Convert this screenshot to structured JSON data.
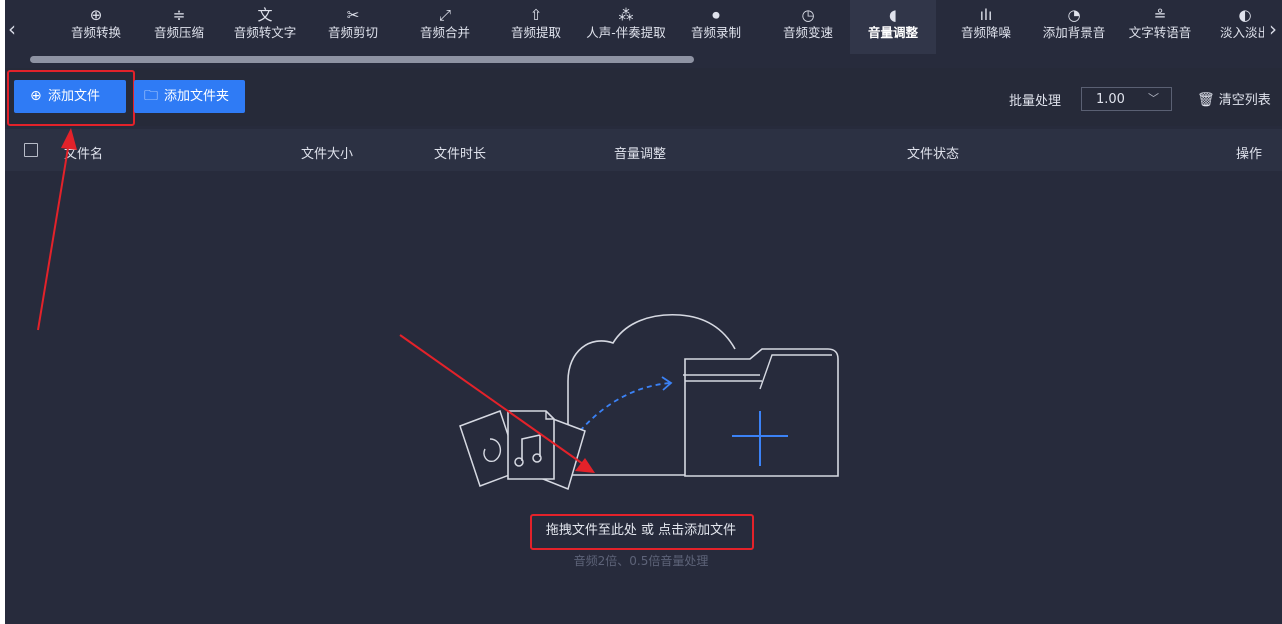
{
  "toolbar": {
    "prev_arrow": "‹",
    "next_arrow": "›",
    "items": [
      {
        "label": "音频转换",
        "icon": "audio-convert-icon",
        "glyph": "⊕"
      },
      {
        "label": "音频压缩",
        "icon": "audio-compress-icon",
        "glyph": "≑"
      },
      {
        "label": "音频转文字",
        "icon": "audio-to-text-icon",
        "glyph": "文"
      },
      {
        "label": "音频剪切",
        "icon": "scissors-icon",
        "glyph": "✂"
      },
      {
        "label": "音频合并",
        "icon": "merge-icon",
        "glyph": "⤢"
      },
      {
        "label": "音频提取",
        "icon": "extract-icon",
        "glyph": "⇧"
      },
      {
        "label": "人声-伴奏提取",
        "icon": "vocal-extract-icon",
        "glyph": "⁂"
      },
      {
        "label": "音频录制",
        "icon": "microphone-icon",
        "glyph": "⏺"
      },
      {
        "label": "音频变速",
        "icon": "speed-icon",
        "glyph": "◷"
      },
      {
        "label": "音量调整",
        "icon": "volume-icon",
        "glyph": "◖"
      },
      {
        "label": "音频降噪",
        "icon": "denoise-icon",
        "glyph": "ılı"
      },
      {
        "label": "添加背景音",
        "icon": "background-music-icon",
        "glyph": "◔"
      },
      {
        "label": "文字转语音",
        "icon": "text-to-speech-icon",
        "glyph": "≗"
      },
      {
        "label": "淡入淡出",
        "icon": "fade-icon",
        "glyph": "◐"
      }
    ],
    "active_index": 9
  },
  "actions": {
    "add_file": "添加文件",
    "add_folder": "添加文件夹",
    "add_file_icon": "plus-circle-icon",
    "add_folder_icon": "folder-icon",
    "batch_label": "批量处理",
    "batch_value": "1.00",
    "clear_list": "清空列表",
    "clear_icon": "trash-icon"
  },
  "table": {
    "columns": {
      "name": "文件名",
      "size": "文件大小",
      "duration": "文件时长",
      "volume": "音量调整",
      "status": "文件状态",
      "operation": "操作"
    }
  },
  "empty": {
    "hint": "拖拽文件至此处 或 点击添加文件",
    "sub": "音频2倍、0.5倍音量处理"
  },
  "colors": {
    "background": "#272b3c",
    "accent": "#2f7bf5",
    "annotation": "#e3222a"
  }
}
